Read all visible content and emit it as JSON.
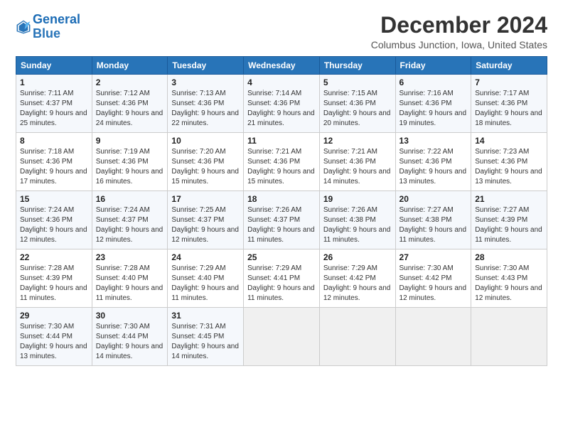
{
  "header": {
    "logo_line1": "General",
    "logo_line2": "Blue",
    "month_title": "December 2024",
    "location": "Columbus Junction, Iowa, United States"
  },
  "weekdays": [
    "Sunday",
    "Monday",
    "Tuesday",
    "Wednesday",
    "Thursday",
    "Friday",
    "Saturday"
  ],
  "weeks": [
    [
      {
        "day": "1",
        "sunrise": "Sunrise: 7:11 AM",
        "sunset": "Sunset: 4:37 PM",
        "daylight": "Daylight: 9 hours and 25 minutes."
      },
      {
        "day": "2",
        "sunrise": "Sunrise: 7:12 AM",
        "sunset": "Sunset: 4:36 PM",
        "daylight": "Daylight: 9 hours and 24 minutes."
      },
      {
        "day": "3",
        "sunrise": "Sunrise: 7:13 AM",
        "sunset": "Sunset: 4:36 PM",
        "daylight": "Daylight: 9 hours and 22 minutes."
      },
      {
        "day": "4",
        "sunrise": "Sunrise: 7:14 AM",
        "sunset": "Sunset: 4:36 PM",
        "daylight": "Daylight: 9 hours and 21 minutes."
      },
      {
        "day": "5",
        "sunrise": "Sunrise: 7:15 AM",
        "sunset": "Sunset: 4:36 PM",
        "daylight": "Daylight: 9 hours and 20 minutes."
      },
      {
        "day": "6",
        "sunrise": "Sunrise: 7:16 AM",
        "sunset": "Sunset: 4:36 PM",
        "daylight": "Daylight: 9 hours and 19 minutes."
      },
      {
        "day": "7",
        "sunrise": "Sunrise: 7:17 AM",
        "sunset": "Sunset: 4:36 PM",
        "daylight": "Daylight: 9 hours and 18 minutes."
      }
    ],
    [
      {
        "day": "8",
        "sunrise": "Sunrise: 7:18 AM",
        "sunset": "Sunset: 4:36 PM",
        "daylight": "Daylight: 9 hours and 17 minutes."
      },
      {
        "day": "9",
        "sunrise": "Sunrise: 7:19 AM",
        "sunset": "Sunset: 4:36 PM",
        "daylight": "Daylight: 9 hours and 16 minutes."
      },
      {
        "day": "10",
        "sunrise": "Sunrise: 7:20 AM",
        "sunset": "Sunset: 4:36 PM",
        "daylight": "Daylight: 9 hours and 15 minutes."
      },
      {
        "day": "11",
        "sunrise": "Sunrise: 7:21 AM",
        "sunset": "Sunset: 4:36 PM",
        "daylight": "Daylight: 9 hours and 15 minutes."
      },
      {
        "day": "12",
        "sunrise": "Sunrise: 7:21 AM",
        "sunset": "Sunset: 4:36 PM",
        "daylight": "Daylight: 9 hours and 14 minutes."
      },
      {
        "day": "13",
        "sunrise": "Sunrise: 7:22 AM",
        "sunset": "Sunset: 4:36 PM",
        "daylight": "Daylight: 9 hours and 13 minutes."
      },
      {
        "day": "14",
        "sunrise": "Sunrise: 7:23 AM",
        "sunset": "Sunset: 4:36 PM",
        "daylight": "Daylight: 9 hours and 13 minutes."
      }
    ],
    [
      {
        "day": "15",
        "sunrise": "Sunrise: 7:24 AM",
        "sunset": "Sunset: 4:36 PM",
        "daylight": "Daylight: 9 hours and 12 minutes."
      },
      {
        "day": "16",
        "sunrise": "Sunrise: 7:24 AM",
        "sunset": "Sunset: 4:37 PM",
        "daylight": "Daylight: 9 hours and 12 minutes."
      },
      {
        "day": "17",
        "sunrise": "Sunrise: 7:25 AM",
        "sunset": "Sunset: 4:37 PM",
        "daylight": "Daylight: 9 hours and 12 minutes."
      },
      {
        "day": "18",
        "sunrise": "Sunrise: 7:26 AM",
        "sunset": "Sunset: 4:37 PM",
        "daylight": "Daylight: 9 hours and 11 minutes."
      },
      {
        "day": "19",
        "sunrise": "Sunrise: 7:26 AM",
        "sunset": "Sunset: 4:38 PM",
        "daylight": "Daylight: 9 hours and 11 minutes."
      },
      {
        "day": "20",
        "sunrise": "Sunrise: 7:27 AM",
        "sunset": "Sunset: 4:38 PM",
        "daylight": "Daylight: 9 hours and 11 minutes."
      },
      {
        "day": "21",
        "sunrise": "Sunrise: 7:27 AM",
        "sunset": "Sunset: 4:39 PM",
        "daylight": "Daylight: 9 hours and 11 minutes."
      }
    ],
    [
      {
        "day": "22",
        "sunrise": "Sunrise: 7:28 AM",
        "sunset": "Sunset: 4:39 PM",
        "daylight": "Daylight: 9 hours and 11 minutes."
      },
      {
        "day": "23",
        "sunrise": "Sunrise: 7:28 AM",
        "sunset": "Sunset: 4:40 PM",
        "daylight": "Daylight: 9 hours and 11 minutes."
      },
      {
        "day": "24",
        "sunrise": "Sunrise: 7:29 AM",
        "sunset": "Sunset: 4:40 PM",
        "daylight": "Daylight: 9 hours and 11 minutes."
      },
      {
        "day": "25",
        "sunrise": "Sunrise: 7:29 AM",
        "sunset": "Sunset: 4:41 PM",
        "daylight": "Daylight: 9 hours and 11 minutes."
      },
      {
        "day": "26",
        "sunrise": "Sunrise: 7:29 AM",
        "sunset": "Sunset: 4:42 PM",
        "daylight": "Daylight: 9 hours and 12 minutes."
      },
      {
        "day": "27",
        "sunrise": "Sunrise: 7:30 AM",
        "sunset": "Sunset: 4:42 PM",
        "daylight": "Daylight: 9 hours and 12 minutes."
      },
      {
        "day": "28",
        "sunrise": "Sunrise: 7:30 AM",
        "sunset": "Sunset: 4:43 PM",
        "daylight": "Daylight: 9 hours and 12 minutes."
      }
    ],
    [
      {
        "day": "29",
        "sunrise": "Sunrise: 7:30 AM",
        "sunset": "Sunset: 4:44 PM",
        "daylight": "Daylight: 9 hours and 13 minutes."
      },
      {
        "day": "30",
        "sunrise": "Sunrise: 7:30 AM",
        "sunset": "Sunset: 4:44 PM",
        "daylight": "Daylight: 9 hours and 14 minutes."
      },
      {
        "day": "31",
        "sunrise": "Sunrise: 7:31 AM",
        "sunset": "Sunset: 4:45 PM",
        "daylight": "Daylight: 9 hours and 14 minutes."
      },
      null,
      null,
      null,
      null
    ]
  ]
}
